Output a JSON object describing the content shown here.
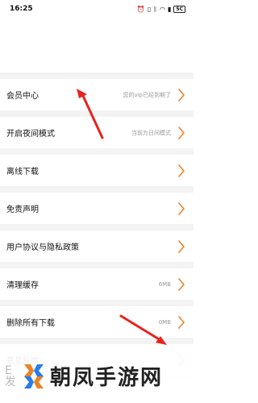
{
  "status_bar": {
    "time": "16:25",
    "battery": "5C",
    "icons": [
      "alarm-icon",
      "mute-icon",
      "bluetooth-icon",
      "wifi-icon",
      "signal-icon",
      "battery-icon"
    ]
  },
  "settings": {
    "items": [
      {
        "label": "会员中心",
        "value": "您的vip已经到期了"
      },
      {
        "label": "开启夜间模式",
        "value": "当前为日间模式"
      },
      {
        "label": "离线下载",
        "value": ""
      },
      {
        "label": "免责声明",
        "value": ""
      },
      {
        "label": "用户协议与隐私政策",
        "value": ""
      },
      {
        "label": "清理缓存",
        "value": "6MB"
      },
      {
        "label": "删除所有下载",
        "value": "0MB"
      },
      {
        "label": "意见反馈",
        "value": ""
      }
    ]
  },
  "watermark": {
    "text": "朝凤手游网",
    "partial_left": "E 发"
  },
  "colors": {
    "chevron": "#e8832a",
    "arrow": "#e8231f",
    "separator": "#f3f3f3"
  }
}
